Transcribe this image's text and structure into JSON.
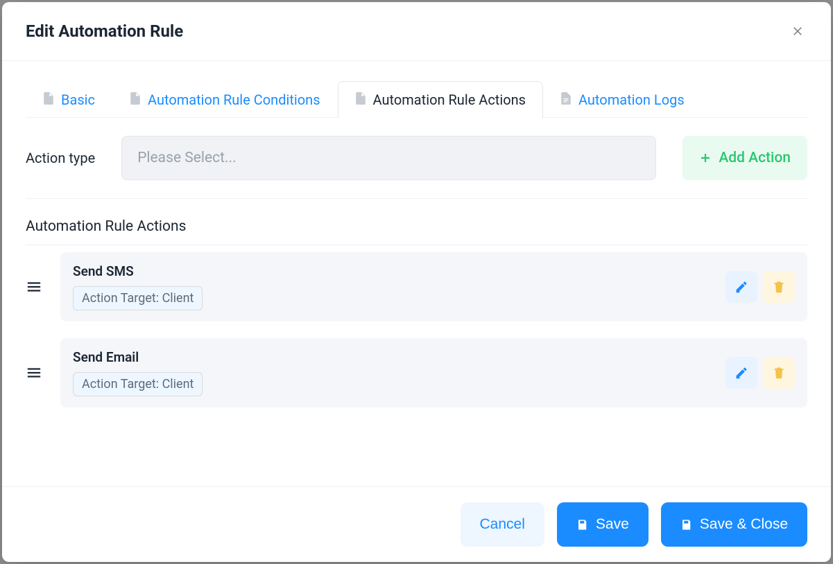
{
  "modal": {
    "title": "Edit Automation Rule"
  },
  "tabs": [
    {
      "label": "Basic",
      "active": false
    },
    {
      "label": "Automation Rule Conditions",
      "active": false
    },
    {
      "label": "Automation Rule Actions",
      "active": true
    },
    {
      "label": "Automation Logs",
      "active": false
    }
  ],
  "action_type": {
    "label": "Action type",
    "placeholder": "Please Select..."
  },
  "add_action": {
    "label": "Add Action"
  },
  "section_title": "Automation Rule Actions",
  "actions": [
    {
      "name": "Send SMS",
      "target": "Action Target: Client"
    },
    {
      "name": "Send Email",
      "target": "Action Target: Client"
    }
  ],
  "footer": {
    "cancel": "Cancel",
    "save": "Save",
    "save_close": "Save & Close"
  }
}
